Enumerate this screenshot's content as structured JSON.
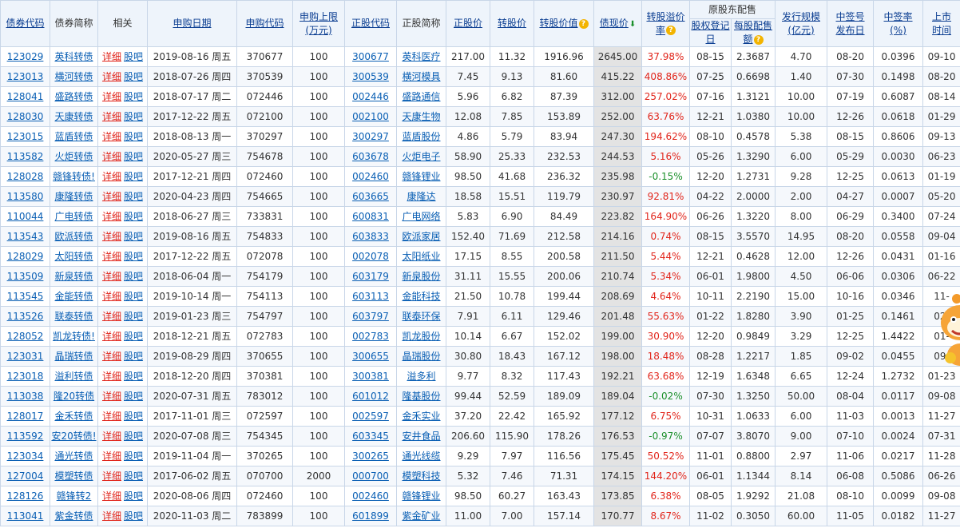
{
  "headers": {
    "code": "债券代码",
    "name": "债券简称",
    "related": "相关",
    "sub_date": "申购日期",
    "sub_code": "申购代码",
    "limit_l1": "申购上限",
    "limit_l2": "(万元)",
    "stock_code": "正股代码",
    "stock_name": "正股简称",
    "stock_price": "正股价",
    "conv_price": "转股价",
    "conv_value": "转股价值",
    "bond_price": "债现价",
    "premium_l1": "转股溢价",
    "premium_l2": "率",
    "placement_group": "原股东配售",
    "record_l1": "股权登记",
    "record_l2": "日",
    "per_share_l1": "每股配售",
    "per_share_l2": "额",
    "issue_l1": "发行规模",
    "issue_l2": "(亿元)",
    "lot_l1": "中签号",
    "lot_l2": "发布日",
    "rate_l1": "中签率",
    "rate_l2": "(%)",
    "list_l1": "上市",
    "list_l2": "时间"
  },
  "links": {
    "detail": "详细",
    "guba": "股吧"
  },
  "colors": {
    "positive": "#e1251b",
    "negative": "#1a8f2a",
    "link": "#0a5fb4",
    "header_bg": "#eef4fb"
  },
  "rows": [
    {
      "code": "123029",
      "name": "英科转债",
      "date": "2019-08-16 周五",
      "sub_code": "370677",
      "limit": "100",
      "stock_code": "300677",
      "stock_name": "英科医疗",
      "stock_price": "217.00",
      "conv_price": "11.32",
      "conv_value": "1916.96",
      "bond_price": "2645.00",
      "premium": "37.98%",
      "record": "08-15",
      "per_share": "2.3687",
      "issue": "4.70",
      "lot_date": "08-20",
      "rate": "0.0396",
      "list": "09-10"
    },
    {
      "code": "123013",
      "name": "横河转债",
      "date": "2018-07-26 周四",
      "sub_code": "370539",
      "limit": "100",
      "stock_code": "300539",
      "stock_name": "横河模具",
      "stock_price": "7.45",
      "conv_price": "9.13",
      "conv_value": "81.60",
      "bond_price": "415.22",
      "premium": "408.86%",
      "record": "07-25",
      "per_share": "0.6698",
      "issue": "1.40",
      "lot_date": "07-30",
      "rate": "0.1498",
      "list": "08-20"
    },
    {
      "code": "128041",
      "name": "盛路转债",
      "date": "2018-07-17 周二",
      "sub_code": "072446",
      "limit": "100",
      "stock_code": "002446",
      "stock_name": "盛路通信",
      "stock_price": "5.96",
      "conv_price": "6.82",
      "conv_value": "87.39",
      "bond_price": "312.00",
      "premium": "257.02%",
      "record": "07-16",
      "per_share": "1.3121",
      "issue": "10.00",
      "lot_date": "07-19",
      "rate": "0.6087",
      "list": "08-14"
    },
    {
      "code": "128030",
      "name": "天康转债",
      "date": "2017-12-22 周五",
      "sub_code": "072100",
      "limit": "100",
      "stock_code": "002100",
      "stock_name": "天康生物",
      "stock_price": "12.08",
      "conv_price": "7.85",
      "conv_value": "153.89",
      "bond_price": "252.00",
      "premium": "63.76%",
      "record": "12-21",
      "per_share": "1.0380",
      "issue": "10.00",
      "lot_date": "12-26",
      "rate": "0.0618",
      "list": "01-29"
    },
    {
      "code": "123015",
      "name": "蓝盾转债",
      "date": "2018-08-13 周一",
      "sub_code": "370297",
      "limit": "100",
      "stock_code": "300297",
      "stock_name": "蓝盾股份",
      "stock_price": "4.86",
      "conv_price": "5.79",
      "conv_value": "83.94",
      "bond_price": "247.30",
      "premium": "194.62%",
      "record": "08-10",
      "per_share": "0.4578",
      "issue": "5.38",
      "lot_date": "08-15",
      "rate": "0.8606",
      "list": "09-13"
    },
    {
      "code": "113582",
      "name": "火炬转债",
      "date": "2020-05-27 周三",
      "sub_code": "754678",
      "limit": "100",
      "stock_code": "603678",
      "stock_name": "火炬电子",
      "stock_price": "58.90",
      "conv_price": "25.33",
      "conv_value": "232.53",
      "bond_price": "244.53",
      "premium": "5.16%",
      "record": "05-26",
      "per_share": "1.3290",
      "issue": "6.00",
      "lot_date": "05-29",
      "rate": "0.0030",
      "list": "06-23"
    },
    {
      "code": "128028",
      "name": "赣锋转债!",
      "date": "2017-12-21 周四",
      "sub_code": "072460",
      "limit": "100",
      "stock_code": "002460",
      "stock_name": "赣锋锂业",
      "stock_price": "98.50",
      "conv_price": "41.68",
      "conv_value": "236.32",
      "bond_price": "235.98",
      "premium": "-0.15%",
      "record": "12-20",
      "per_share": "1.2731",
      "issue": "9.28",
      "lot_date": "12-25",
      "rate": "0.0613",
      "list": "01-19"
    },
    {
      "code": "113580",
      "name": "康隆转债",
      "date": "2020-04-23 周四",
      "sub_code": "754665",
      "limit": "100",
      "stock_code": "603665",
      "stock_name": "康隆达",
      "stock_price": "18.58",
      "conv_price": "15.51",
      "conv_value": "119.79",
      "bond_price": "230.97",
      "premium": "92.81%",
      "record": "04-22",
      "per_share": "2.0000",
      "issue": "2.00",
      "lot_date": "04-27",
      "rate": "0.0007",
      "list": "05-20"
    },
    {
      "code": "110044",
      "name": "广电转债",
      "date": "2018-06-27 周三",
      "sub_code": "733831",
      "limit": "100",
      "stock_code": "600831",
      "stock_name": "广电网络",
      "stock_price": "5.83",
      "conv_price": "6.90",
      "conv_value": "84.49",
      "bond_price": "223.82",
      "premium": "164.90%",
      "record": "06-26",
      "per_share": "1.3220",
      "issue": "8.00",
      "lot_date": "06-29",
      "rate": "0.3400",
      "list": "07-24"
    },
    {
      "code": "113543",
      "name": "欧派转债",
      "date": "2019-08-16 周五",
      "sub_code": "754833",
      "limit": "100",
      "stock_code": "603833",
      "stock_name": "欧派家居",
      "stock_price": "152.40",
      "conv_price": "71.69",
      "conv_value": "212.58",
      "bond_price": "214.16",
      "premium": "0.74%",
      "record": "08-15",
      "per_share": "3.5570",
      "issue": "14.95",
      "lot_date": "08-20",
      "rate": "0.0558",
      "list": "09-04"
    },
    {
      "code": "128029",
      "name": "太阳转债",
      "date": "2017-12-22 周五",
      "sub_code": "072078",
      "limit": "100",
      "stock_code": "002078",
      "stock_name": "太阳纸业",
      "stock_price": "17.15",
      "conv_price": "8.55",
      "conv_value": "200.58",
      "bond_price": "211.50",
      "premium": "5.44%",
      "record": "12-21",
      "per_share": "0.4628",
      "issue": "12.00",
      "lot_date": "12-26",
      "rate": "0.0431",
      "list": "01-16"
    },
    {
      "code": "113509",
      "name": "新泉转债",
      "date": "2018-06-04 周一",
      "sub_code": "754179",
      "limit": "100",
      "stock_code": "603179",
      "stock_name": "新泉股份",
      "stock_price": "31.11",
      "conv_price": "15.55",
      "conv_value": "200.06",
      "bond_price": "210.74",
      "premium": "5.34%",
      "record": "06-01",
      "per_share": "1.9800",
      "issue": "4.50",
      "lot_date": "06-06",
      "rate": "0.0306",
      "list": "06-22"
    },
    {
      "code": "113545",
      "name": "金能转债",
      "date": "2019-10-14 周一",
      "sub_code": "754113",
      "limit": "100",
      "stock_code": "603113",
      "stock_name": "金能科技",
      "stock_price": "21.50",
      "conv_price": "10.78",
      "conv_value": "199.44",
      "bond_price": "208.69",
      "premium": "4.64%",
      "record": "10-11",
      "per_share": "2.2190",
      "issue": "15.00",
      "lot_date": "10-16",
      "rate": "0.0346",
      "list": "11-"
    },
    {
      "code": "113526",
      "name": "联泰转债",
      "date": "2019-01-23 周三",
      "sub_code": "754797",
      "limit": "100",
      "stock_code": "603797",
      "stock_name": "联泰环保",
      "stock_price": "7.91",
      "conv_price": "6.11",
      "conv_value": "129.46",
      "bond_price": "201.48",
      "premium": "55.63%",
      "record": "01-22",
      "per_share": "1.8280",
      "issue": "3.90",
      "lot_date": "01-25",
      "rate": "0.1461",
      "list": "02-"
    },
    {
      "code": "128052",
      "name": "凯龙转债!",
      "date": "2018-12-21 周五",
      "sub_code": "072783",
      "limit": "100",
      "stock_code": "002783",
      "stock_name": "凯龙股份",
      "stock_price": "10.14",
      "conv_price": "6.67",
      "conv_value": "152.02",
      "bond_price": "199.00",
      "premium": "30.90%",
      "record": "12-20",
      "per_share": "0.9849",
      "issue": "3.29",
      "lot_date": "12-25",
      "rate": "1.4422",
      "list": "01-"
    },
    {
      "code": "123031",
      "name": "晶瑞转债",
      "date": "2019-08-29 周四",
      "sub_code": "370655",
      "limit": "100",
      "stock_code": "300655",
      "stock_name": "晶瑞股份",
      "stock_price": "30.80",
      "conv_price": "18.43",
      "conv_value": "167.12",
      "bond_price": "198.00",
      "premium": "18.48%",
      "record": "08-28",
      "per_share": "1.2217",
      "issue": "1.85",
      "lot_date": "09-02",
      "rate": "0.0455",
      "list": "09-"
    },
    {
      "code": "123018",
      "name": "溢利转债",
      "date": "2018-12-20 周四",
      "sub_code": "370381",
      "limit": "100",
      "stock_code": "300381",
      "stock_name": "溢多利",
      "stock_price": "9.77",
      "conv_price": "8.32",
      "conv_value": "117.43",
      "bond_price": "192.21",
      "premium": "63.68%",
      "record": "12-19",
      "per_share": "1.6348",
      "issue": "6.65",
      "lot_date": "12-24",
      "rate": "1.2732",
      "list": "01-23"
    },
    {
      "code": "113038",
      "name": "隆20转债",
      "date": "2020-07-31 周五",
      "sub_code": "783012",
      "limit": "100",
      "stock_code": "601012",
      "stock_name": "隆基股份",
      "stock_price": "99.44",
      "conv_price": "52.59",
      "conv_value": "189.09",
      "bond_price": "189.04",
      "premium": "-0.02%",
      "record": "07-30",
      "per_share": "1.3250",
      "issue": "50.00",
      "lot_date": "08-04",
      "rate": "0.0117",
      "list": "09-08"
    },
    {
      "code": "128017",
      "name": "金禾转债",
      "date": "2017-11-01 周三",
      "sub_code": "072597",
      "limit": "100",
      "stock_code": "002597",
      "stock_name": "金禾实业",
      "stock_price": "37.20",
      "conv_price": "22.42",
      "conv_value": "165.92",
      "bond_price": "177.12",
      "premium": "6.75%",
      "record": "10-31",
      "per_share": "1.0633",
      "issue": "6.00",
      "lot_date": "11-03",
      "rate": "0.0013",
      "list": "11-27"
    },
    {
      "code": "113592",
      "name": "安20转债!",
      "date": "2020-07-08 周三",
      "sub_code": "754345",
      "limit": "100",
      "stock_code": "603345",
      "stock_name": "安井食品",
      "stock_price": "206.60",
      "conv_price": "115.90",
      "conv_value": "178.26",
      "bond_price": "176.53",
      "premium": "-0.97%",
      "record": "07-07",
      "per_share": "3.8070",
      "issue": "9.00",
      "lot_date": "07-10",
      "rate": "0.0024",
      "list": "07-31"
    },
    {
      "code": "123034",
      "name": "通光转债",
      "date": "2019-11-04 周一",
      "sub_code": "370265",
      "limit": "100",
      "stock_code": "300265",
      "stock_name": "通光线缆",
      "stock_price": "9.29",
      "conv_price": "7.97",
      "conv_value": "116.56",
      "bond_price": "175.45",
      "premium": "50.52%",
      "record": "11-01",
      "per_share": "0.8800",
      "issue": "2.97",
      "lot_date": "11-06",
      "rate": "0.0217",
      "list": "11-28"
    },
    {
      "code": "127004",
      "name": "模塑转债",
      "date": "2017-06-02 周五",
      "sub_code": "070700",
      "limit": "2000",
      "stock_code": "000700",
      "stock_name": "模塑科技",
      "stock_price": "5.32",
      "conv_price": "7.46",
      "conv_value": "71.31",
      "bond_price": "174.15",
      "premium": "144.20%",
      "record": "06-01",
      "per_share": "1.1344",
      "issue": "8.14",
      "lot_date": "06-08",
      "rate": "0.5086",
      "list": "06-26"
    },
    {
      "code": "128126",
      "name": "赣锋转2",
      "date": "2020-08-06 周四",
      "sub_code": "072460",
      "limit": "100",
      "stock_code": "002460",
      "stock_name": "赣锋锂业",
      "stock_price": "98.50",
      "conv_price": "60.27",
      "conv_value": "163.43",
      "bond_price": "173.85",
      "premium": "6.38%",
      "record": "08-05",
      "per_share": "1.9292",
      "issue": "21.08",
      "lot_date": "08-10",
      "rate": "0.0099",
      "list": "09-08"
    },
    {
      "code": "113041",
      "name": "紫金转债",
      "date": "2020-11-03 周二",
      "sub_code": "783899",
      "limit": "100",
      "stock_code": "601899",
      "stock_name": "紫金矿业",
      "stock_price": "11.00",
      "conv_price": "7.00",
      "conv_value": "157.14",
      "bond_price": "170.77",
      "premium": "8.67%",
      "record": "11-02",
      "per_share": "0.3050",
      "issue": "60.00",
      "lot_date": "11-05",
      "rate": "0.0182",
      "list": "11-27"
    }
  ]
}
